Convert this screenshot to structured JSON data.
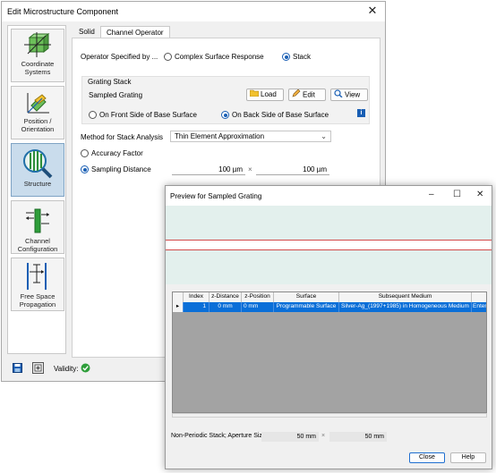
{
  "main": {
    "title": "Edit Microstructure Component",
    "close_glyph": "✕",
    "nav": [
      {
        "label": "Coordinate Systems",
        "icon": "coordinate-systems-icon"
      },
      {
        "label": "Position / Orientation",
        "icon": "position-orientation-icon"
      },
      {
        "label": "Structure",
        "icon": "structure-icon",
        "active": true
      },
      {
        "label": "Channel Configuration",
        "icon": "channel-configuration-icon"
      },
      {
        "label": "Free Space Propagation",
        "icon": "free-space-propagation-icon"
      }
    ],
    "tabs": [
      "Solid",
      "Channel Operator"
    ],
    "operator": {
      "label": "Operator Specified by ...",
      "options": [
        "Complex Surface Response",
        "Stack"
      ],
      "selected": "Stack"
    },
    "grating_stack": {
      "title": "Grating Stack",
      "name": "Sampled Grating",
      "buttons": {
        "load": "Load",
        "edit": "Edit",
        "view": "View"
      },
      "side_options": [
        "On Front Side of Base Surface",
        "On Back Side of Base Surface"
      ],
      "selected_side": "On Back Side of Base Surface",
      "info_glyph": "i"
    },
    "method": {
      "label": "Method for Stack Analysis",
      "value": "Thin Element Approximation",
      "chevron": "⌄"
    },
    "accuracy_factor": "Accuracy Factor",
    "sampling": {
      "label": "Sampling Distance",
      "x": "100 µm",
      "times": "×",
      "y": "100 µm"
    },
    "status": {
      "validity_label": "Validity:"
    }
  },
  "preview": {
    "title": "Preview for Sampled Grating",
    "window_controls": {
      "minimize": "–",
      "maximize": "☐",
      "close": "✕"
    },
    "table": {
      "columns": [
        "",
        "Index",
        "z-Distance",
        "z-Position",
        "Surface",
        "Subsequent Medium",
        ""
      ],
      "row": [
        "▸",
        "1",
        "0 mm",
        "0 mm",
        "Programmable Surface",
        "Silver-Ag_(1997+1985) in Homogeneous Medium",
        "Enter"
      ]
    },
    "aperture": {
      "label": "Non-Periodic Stack; Aperture Size",
      "x": "50 mm",
      "times": "×",
      "y": "50 mm"
    },
    "buttons": {
      "close": "Close",
      "help": "Help"
    }
  },
  "colors": {
    "accent": "#1a5fb4",
    "selection": "#0a6fd8",
    "validity_ok": "#2e9e3a",
    "preview_pane": "#e3f0ed",
    "boundary_line": "#d34a4a"
  }
}
